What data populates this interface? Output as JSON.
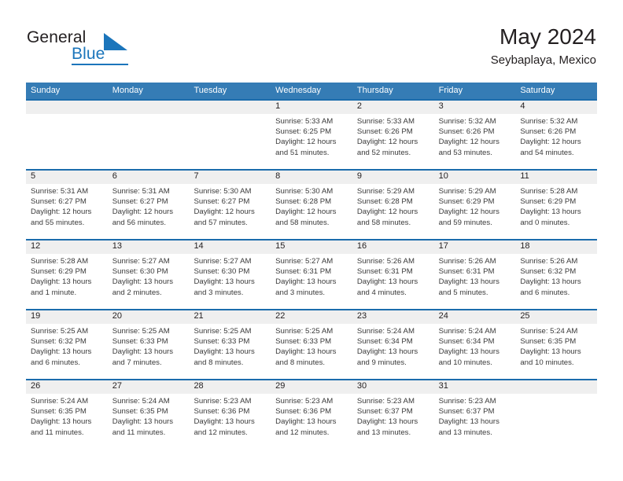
{
  "brand": {
    "name_part1": "General",
    "name_part2": "Blue",
    "logo_icon": "triangle-logo-icon",
    "accent_color": "#1b75bb"
  },
  "header": {
    "month_title": "May 2024",
    "location": "Seybaplaya, Mexico"
  },
  "theme": {
    "header_row_bg": "#357cb5",
    "row_divider": "#1b6cac",
    "day_band_bg": "#efefef",
    "text_color": "#231f20"
  },
  "weekdays": [
    "Sunday",
    "Monday",
    "Tuesday",
    "Wednesday",
    "Thursday",
    "Friday",
    "Saturday"
  ],
  "calendar": {
    "weeks": [
      [
        {
          "day": "",
          "empty": true
        },
        {
          "day": "",
          "empty": true
        },
        {
          "day": "",
          "empty": true
        },
        {
          "day": "1",
          "sunrise": "Sunrise: 5:33 AM",
          "sunset": "Sunset: 6:25 PM",
          "daylight_line1": "Daylight: 12 hours",
          "daylight_line2": "and 51 minutes."
        },
        {
          "day": "2",
          "sunrise": "Sunrise: 5:33 AM",
          "sunset": "Sunset: 6:26 PM",
          "daylight_line1": "Daylight: 12 hours",
          "daylight_line2": "and 52 minutes."
        },
        {
          "day": "3",
          "sunrise": "Sunrise: 5:32 AM",
          "sunset": "Sunset: 6:26 PM",
          "daylight_line1": "Daylight: 12 hours",
          "daylight_line2": "and 53 minutes."
        },
        {
          "day": "4",
          "sunrise": "Sunrise: 5:32 AM",
          "sunset": "Sunset: 6:26 PM",
          "daylight_line1": "Daylight: 12 hours",
          "daylight_line2": "and 54 minutes."
        }
      ],
      [
        {
          "day": "5",
          "sunrise": "Sunrise: 5:31 AM",
          "sunset": "Sunset: 6:27 PM",
          "daylight_line1": "Daylight: 12 hours",
          "daylight_line2": "and 55 minutes."
        },
        {
          "day": "6",
          "sunrise": "Sunrise: 5:31 AM",
          "sunset": "Sunset: 6:27 PM",
          "daylight_line1": "Daylight: 12 hours",
          "daylight_line2": "and 56 minutes."
        },
        {
          "day": "7",
          "sunrise": "Sunrise: 5:30 AM",
          "sunset": "Sunset: 6:27 PM",
          "daylight_line1": "Daylight: 12 hours",
          "daylight_line2": "and 57 minutes."
        },
        {
          "day": "8",
          "sunrise": "Sunrise: 5:30 AM",
          "sunset": "Sunset: 6:28 PM",
          "daylight_line1": "Daylight: 12 hours",
          "daylight_line2": "and 58 minutes."
        },
        {
          "day": "9",
          "sunrise": "Sunrise: 5:29 AM",
          "sunset": "Sunset: 6:28 PM",
          "daylight_line1": "Daylight: 12 hours",
          "daylight_line2": "and 58 minutes."
        },
        {
          "day": "10",
          "sunrise": "Sunrise: 5:29 AM",
          "sunset": "Sunset: 6:29 PM",
          "daylight_line1": "Daylight: 12 hours",
          "daylight_line2": "and 59 minutes."
        },
        {
          "day": "11",
          "sunrise": "Sunrise: 5:28 AM",
          "sunset": "Sunset: 6:29 PM",
          "daylight_line1": "Daylight: 13 hours",
          "daylight_line2": "and 0 minutes."
        }
      ],
      [
        {
          "day": "12",
          "sunrise": "Sunrise: 5:28 AM",
          "sunset": "Sunset: 6:29 PM",
          "daylight_line1": "Daylight: 13 hours",
          "daylight_line2": "and 1 minute."
        },
        {
          "day": "13",
          "sunrise": "Sunrise: 5:27 AM",
          "sunset": "Sunset: 6:30 PM",
          "daylight_line1": "Daylight: 13 hours",
          "daylight_line2": "and 2 minutes."
        },
        {
          "day": "14",
          "sunrise": "Sunrise: 5:27 AM",
          "sunset": "Sunset: 6:30 PM",
          "daylight_line1": "Daylight: 13 hours",
          "daylight_line2": "and 3 minutes."
        },
        {
          "day": "15",
          "sunrise": "Sunrise: 5:27 AM",
          "sunset": "Sunset: 6:31 PM",
          "daylight_line1": "Daylight: 13 hours",
          "daylight_line2": "and 3 minutes."
        },
        {
          "day": "16",
          "sunrise": "Sunrise: 5:26 AM",
          "sunset": "Sunset: 6:31 PM",
          "daylight_line1": "Daylight: 13 hours",
          "daylight_line2": "and 4 minutes."
        },
        {
          "day": "17",
          "sunrise": "Sunrise: 5:26 AM",
          "sunset": "Sunset: 6:31 PM",
          "daylight_line1": "Daylight: 13 hours",
          "daylight_line2": "and 5 minutes."
        },
        {
          "day": "18",
          "sunrise": "Sunrise: 5:26 AM",
          "sunset": "Sunset: 6:32 PM",
          "daylight_line1": "Daylight: 13 hours",
          "daylight_line2": "and 6 minutes."
        }
      ],
      [
        {
          "day": "19",
          "sunrise": "Sunrise: 5:25 AM",
          "sunset": "Sunset: 6:32 PM",
          "daylight_line1": "Daylight: 13 hours",
          "daylight_line2": "and 6 minutes."
        },
        {
          "day": "20",
          "sunrise": "Sunrise: 5:25 AM",
          "sunset": "Sunset: 6:33 PM",
          "daylight_line1": "Daylight: 13 hours",
          "daylight_line2": "and 7 minutes."
        },
        {
          "day": "21",
          "sunrise": "Sunrise: 5:25 AM",
          "sunset": "Sunset: 6:33 PM",
          "daylight_line1": "Daylight: 13 hours",
          "daylight_line2": "and 8 minutes."
        },
        {
          "day": "22",
          "sunrise": "Sunrise: 5:25 AM",
          "sunset": "Sunset: 6:33 PM",
          "daylight_line1": "Daylight: 13 hours",
          "daylight_line2": "and 8 minutes."
        },
        {
          "day": "23",
          "sunrise": "Sunrise: 5:24 AM",
          "sunset": "Sunset: 6:34 PM",
          "daylight_line1": "Daylight: 13 hours",
          "daylight_line2": "and 9 minutes."
        },
        {
          "day": "24",
          "sunrise": "Sunrise: 5:24 AM",
          "sunset": "Sunset: 6:34 PM",
          "daylight_line1": "Daylight: 13 hours",
          "daylight_line2": "and 10 minutes."
        },
        {
          "day": "25",
          "sunrise": "Sunrise: 5:24 AM",
          "sunset": "Sunset: 6:35 PM",
          "daylight_line1": "Daylight: 13 hours",
          "daylight_line2": "and 10 minutes."
        }
      ],
      [
        {
          "day": "26",
          "sunrise": "Sunrise: 5:24 AM",
          "sunset": "Sunset: 6:35 PM",
          "daylight_line1": "Daylight: 13 hours",
          "daylight_line2": "and 11 minutes."
        },
        {
          "day": "27",
          "sunrise": "Sunrise: 5:24 AM",
          "sunset": "Sunset: 6:35 PM",
          "daylight_line1": "Daylight: 13 hours",
          "daylight_line2": "and 11 minutes."
        },
        {
          "day": "28",
          "sunrise": "Sunrise: 5:23 AM",
          "sunset": "Sunset: 6:36 PM",
          "daylight_line1": "Daylight: 13 hours",
          "daylight_line2": "and 12 minutes."
        },
        {
          "day": "29",
          "sunrise": "Sunrise: 5:23 AM",
          "sunset": "Sunset: 6:36 PM",
          "daylight_line1": "Daylight: 13 hours",
          "daylight_line2": "and 12 minutes."
        },
        {
          "day": "30",
          "sunrise": "Sunrise: 5:23 AM",
          "sunset": "Sunset: 6:37 PM",
          "daylight_line1": "Daylight: 13 hours",
          "daylight_line2": "and 13 minutes."
        },
        {
          "day": "31",
          "sunrise": "Sunrise: 5:23 AM",
          "sunset": "Sunset: 6:37 PM",
          "daylight_line1": "Daylight: 13 hours",
          "daylight_line2": "and 13 minutes."
        },
        {
          "day": "",
          "empty": true
        }
      ]
    ]
  }
}
